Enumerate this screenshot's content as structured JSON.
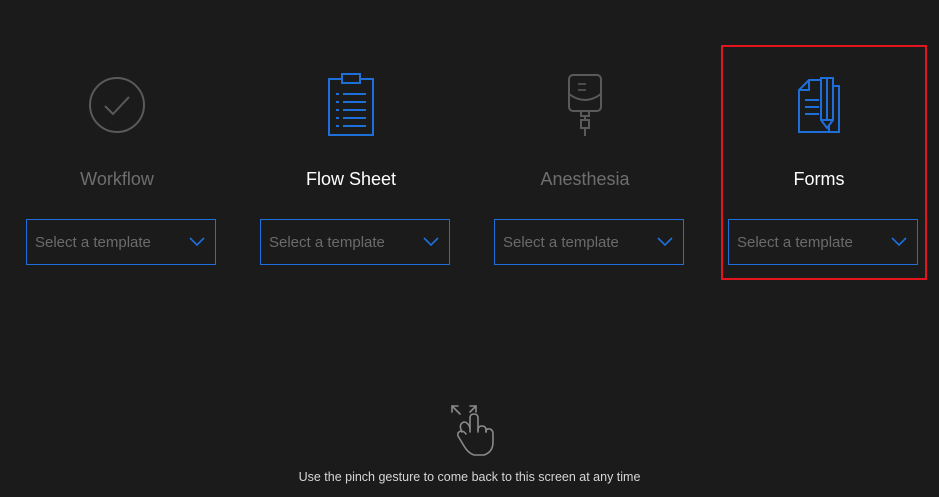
{
  "columns": [
    {
      "id": "workflow",
      "label": "Workflow",
      "placeholder": "Select a template",
      "icon": "check-circle-icon",
      "state": "dim"
    },
    {
      "id": "flow-sheet",
      "label": "Flow Sheet",
      "placeholder": "Select a template",
      "icon": "clipboard-list-icon",
      "state": "active"
    },
    {
      "id": "anesthesia",
      "label": "Anesthesia",
      "placeholder": "Select a template",
      "icon": "iv-bag-icon",
      "state": "dim"
    },
    {
      "id": "forms",
      "label": "Forms",
      "placeholder": "Select a template",
      "icon": "document-pen-icon",
      "state": "active"
    }
  ],
  "hint": {
    "text": "Use the pinch gesture to come back to this screen at any time",
    "icon": "pinch-gesture-icon"
  },
  "colors": {
    "accent": "#1e6fd9",
    "background": "#1b1b1b",
    "dim_text": "#6e6e6e",
    "highlight": "#e3141b"
  }
}
